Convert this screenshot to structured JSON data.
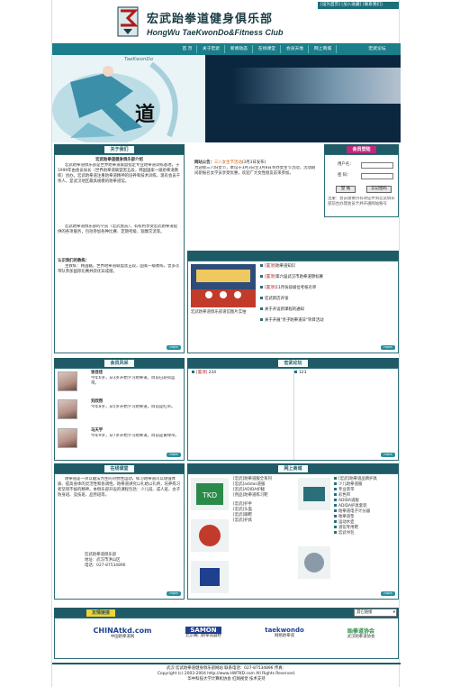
{
  "header": {
    "top_links": "[设为首页] [加入收藏] [联系我们]",
    "logo_cn": "宏武跆拳道健身俱乐部",
    "logo_en": "HongWu TaeKwonDo&Fitness Club"
  },
  "nav": [
    "首 页",
    "关于宏武",
    "新闻动态",
    "在线课堂",
    "会员天地",
    "网上商城",
    "宏武论坛"
  ],
  "banner": {
    "watermark": "TaeKwonDo",
    "char": "道"
  },
  "about": {
    "title": "关于我们",
    "heading": "宏武跆拳道健身俱乐部介绍",
    "para1": "宏武跆拳道俱乐部是世界跆拳道联盟指定专业跆拳道训练基地，于1999年由会员局长（世界跆拳道联盟黑五段，韩国国家一级跆拳道教练）创办。宏武跆拳道注重跆拳道精神的培养和技术训练，现有会员千余人，是武汉地区最具规模的跆拳道馆。",
    "para2": "宏武跆拳道俱乐部的学员（宏武会员），有权利享受宏武跆拳道提供的各项服务，包括参加各种比赛、定期考级、观摩交流等。",
    "sub": "认识我们的教练：",
    "para3": "主教练：韩国籍，世界跆拳道联盟黑五段，国家一级教练，曾多次带队参加国际比赛并获优异成绩。",
    "more": "more"
  },
  "announce": {
    "label": "网站公告：",
    "link": "三八女生节活动",
    "date": "(3月3日发布)",
    "text": "为迎接三八妇女节，本馆于3月3日至3月8日举办女生节活动，活动期间新报名女学员享受优惠，欢迎广大女性朋友前来参加。"
  },
  "login": {
    "title": "会员登陆",
    "user_label": "用户名：",
    "pass_label": "密 码：",
    "user_value": "",
    "pass_value": "",
    "login_btn": "登 陆",
    "forgot_btn": "忘记密码",
    "note": "注册：会员需要持有效证件到宏武俱乐部前台办理会员卡并开通网站账号"
  },
  "news": {
    "items": [
      {
        "tag": "[置顶]",
        "text": "跆拳道知识"
      },
      {
        "tag": "[置顶]",
        "text": "第六届武汉市跆拳道锦标赛"
      },
      {
        "tag": "[置顶]",
        "text": "11月份段级位考核名单"
      },
      {
        "tag": "",
        "text": "宏武新店开张"
      },
      {
        "tag": "",
        "text": "关于开设新课程的通知"
      },
      {
        "tag": "",
        "text": "关于开展\"亲子跆拳道日\"项目活动"
      }
    ],
    "caption": "宏武跆拳道俱乐部道馆图片实拍",
    "more": "more"
  },
  "members": {
    "title": "会员风采",
    "people": [
      {
        "name": "张佳佳",
        "desc": "今年6岁，从3岁开始学习跆拳道，目前已获得蓝带。"
      },
      {
        "name": "刘欣然",
        "desc": "今年8岁，从5岁开始学习跆拳道，目前是红带。"
      },
      {
        "name": "马天宇",
        "desc": "今年9岁，从7岁开始学习跆拳道，目前是黄绿带。"
      }
    ],
    "more": "more"
  },
  "forum": {
    "title": "宏武论坛",
    "left_tag": "[置顶]",
    "left_count": "234",
    "right_count": "123",
    "more": "more"
  },
  "class": {
    "title": "在线课堂",
    "para": "跆拳道是一项以腿法为主的对抗性运动，练习跆拳道可以增强体质、提高身体的灵活性和协调性。跆拳道讲究以礼始以礼终，培养练习者坚韧不拔的精神。本俱乐部开设的课程包括：少儿班、成人班、女子防身班、竞技班、品势班等。",
    "contact1": "宏武跆拳道俱乐部",
    "contact2": "地址：武汉市洪山区",
    "phone": "电话：027-87534896",
    "more": "more"
  },
  "mall": {
    "title": "网上商城",
    "items": [
      "[宏武]跆拳道服全系列",
      "[宏武]adidas道服",
      "[宏武]ADIDA护腿",
      "[用品]跆拳道练习靶",
      "[宏武]护手",
      "[宏武]头盔",
      "[宏武]脚靶",
      "[宏武]护具"
    ],
    "items_right": [
      "[宏武]跆拳道品牌护具",
      "少儿跆拳道服",
      "专业黑带",
      "彩色带",
      "ADIDA道服",
      "ADIDA护具套装",
      "跆拳道电子计分器",
      "跆拳道垫",
      "运动水壶",
      "道馆专用靶",
      "宏武书包"
    ],
    "more": "more"
  },
  "links": {
    "title": "友情链接",
    "select_value": "其它链接",
    "logos": [
      {
        "name": "CHINAtkd.com",
        "caption": "中国跆拳道网"
      },
      {
        "name": "SAMON",
        "caption": "北京赛门跆拳道器材"
      },
      {
        "name": "taekwondo",
        "caption": "网络跆拳道"
      },
      {
        "name": "跆拳道协会",
        "caption": "武汉跆拳道协会"
      }
    ]
  },
  "footer": {
    "line1": "武汉·宏武跆拳道健身俱乐部网站 联系电话：027-87534896 传真：",
    "line2": "Copyright (c) 2003-2004 http://www.HWTKD.com All Rights Reserved.",
    "line3": "华中科技大学计算机协会 红网视觉 技术支持"
  },
  "colors": {
    "primary": "#1f5b66",
    "nav": "#1a7f8a",
    "accent_red": "#b01818"
  }
}
